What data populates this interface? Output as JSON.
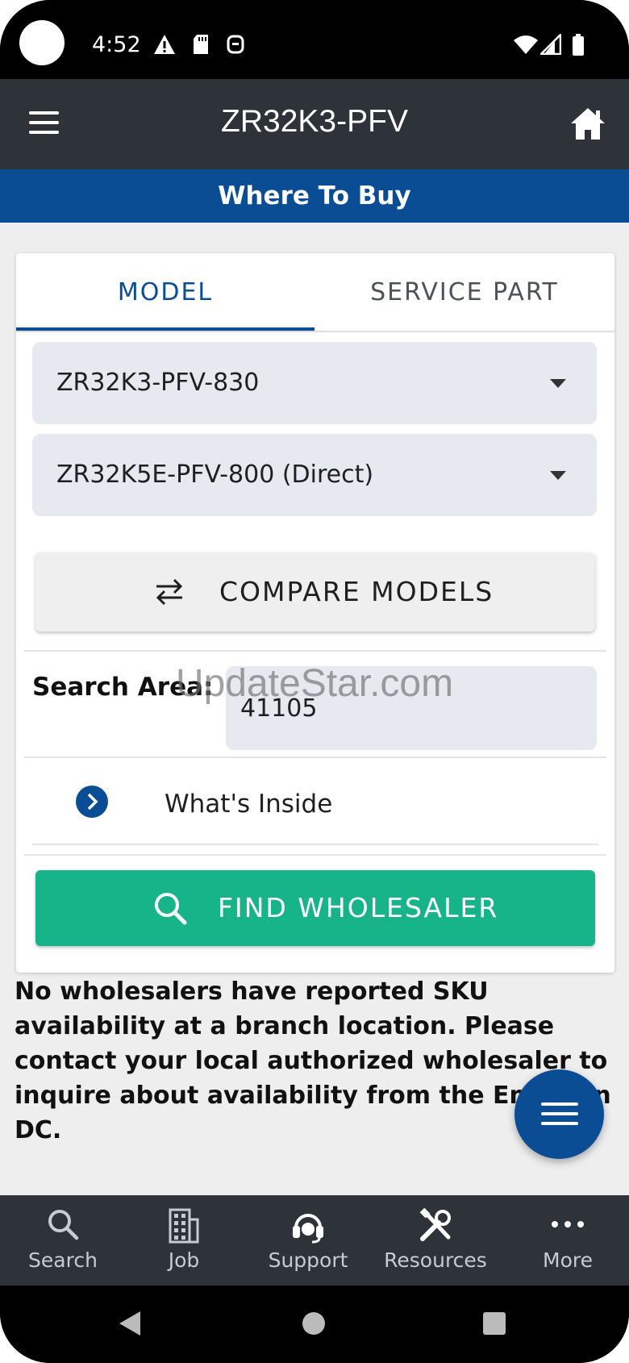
{
  "status_bar": {
    "time": "4:52"
  },
  "app_bar": {
    "title": "ZR32K3-PFV"
  },
  "banner": {
    "title": "Where To Buy"
  },
  "tabs": [
    {
      "label": "MODEL",
      "active": true
    },
    {
      "label": "SERVICE PART",
      "active": false
    }
  ],
  "selects": {
    "model": "ZR32K3-PFV-830",
    "replacement": "ZR32K5E-PFV-800 (Direct)"
  },
  "compare_button": {
    "label": "COMPARE MODELS"
  },
  "search_area": {
    "label": "Search Area:",
    "value": "41105"
  },
  "whats_inside": {
    "label": "What's Inside"
  },
  "find_button": {
    "label": "FIND WHOLESALER"
  },
  "notice": "No wholesalers have reported SKU availability at a branch location. Please contact your local authorized wholesaler to inquire about availability from the Emerson DC.",
  "watermark": "UpdateStar.com",
  "bottom_nav": [
    {
      "label": "Search",
      "icon": "search-icon"
    },
    {
      "label": "Job",
      "icon": "building-icon"
    },
    {
      "label": "Support",
      "icon": "headset-icon"
    },
    {
      "label": "Resources",
      "icon": "tools-icon"
    },
    {
      "label": "More",
      "icon": "more-dots-icon"
    }
  ],
  "colors": {
    "primary_blue": "#0a4d95",
    "app_bar": "#2d3339",
    "find_green": "#17b389",
    "background": "#eeeeef"
  }
}
